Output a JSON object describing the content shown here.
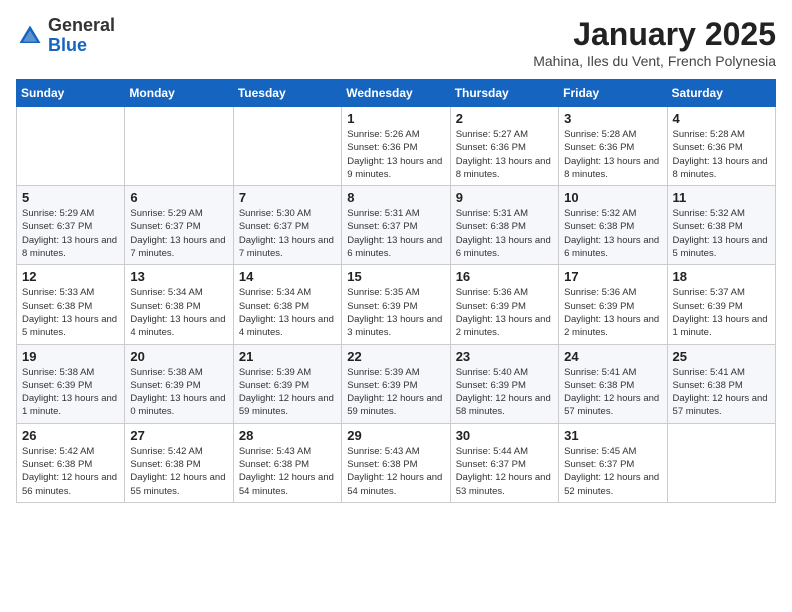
{
  "header": {
    "logo_general": "General",
    "logo_blue": "Blue",
    "title": "January 2025",
    "subtitle": "Mahina, Iles du Vent, French Polynesia"
  },
  "days_of_week": [
    "Sunday",
    "Monday",
    "Tuesday",
    "Wednesday",
    "Thursday",
    "Friday",
    "Saturday"
  ],
  "weeks": [
    [
      {
        "day": "",
        "info": ""
      },
      {
        "day": "",
        "info": ""
      },
      {
        "day": "",
        "info": ""
      },
      {
        "day": "1",
        "info": "Sunrise: 5:26 AM\nSunset: 6:36 PM\nDaylight: 13 hours and 9 minutes."
      },
      {
        "day": "2",
        "info": "Sunrise: 5:27 AM\nSunset: 6:36 PM\nDaylight: 13 hours and 8 minutes."
      },
      {
        "day": "3",
        "info": "Sunrise: 5:28 AM\nSunset: 6:36 PM\nDaylight: 13 hours and 8 minutes."
      },
      {
        "day": "4",
        "info": "Sunrise: 5:28 AM\nSunset: 6:36 PM\nDaylight: 13 hours and 8 minutes."
      }
    ],
    [
      {
        "day": "5",
        "info": "Sunrise: 5:29 AM\nSunset: 6:37 PM\nDaylight: 13 hours and 8 minutes."
      },
      {
        "day": "6",
        "info": "Sunrise: 5:29 AM\nSunset: 6:37 PM\nDaylight: 13 hours and 7 minutes."
      },
      {
        "day": "7",
        "info": "Sunrise: 5:30 AM\nSunset: 6:37 PM\nDaylight: 13 hours and 7 minutes."
      },
      {
        "day": "8",
        "info": "Sunrise: 5:31 AM\nSunset: 6:37 PM\nDaylight: 13 hours and 6 minutes."
      },
      {
        "day": "9",
        "info": "Sunrise: 5:31 AM\nSunset: 6:38 PM\nDaylight: 13 hours and 6 minutes."
      },
      {
        "day": "10",
        "info": "Sunrise: 5:32 AM\nSunset: 6:38 PM\nDaylight: 13 hours and 6 minutes."
      },
      {
        "day": "11",
        "info": "Sunrise: 5:32 AM\nSunset: 6:38 PM\nDaylight: 13 hours and 5 minutes."
      }
    ],
    [
      {
        "day": "12",
        "info": "Sunrise: 5:33 AM\nSunset: 6:38 PM\nDaylight: 13 hours and 5 minutes."
      },
      {
        "day": "13",
        "info": "Sunrise: 5:34 AM\nSunset: 6:38 PM\nDaylight: 13 hours and 4 minutes."
      },
      {
        "day": "14",
        "info": "Sunrise: 5:34 AM\nSunset: 6:38 PM\nDaylight: 13 hours and 4 minutes."
      },
      {
        "day": "15",
        "info": "Sunrise: 5:35 AM\nSunset: 6:39 PM\nDaylight: 13 hours and 3 minutes."
      },
      {
        "day": "16",
        "info": "Sunrise: 5:36 AM\nSunset: 6:39 PM\nDaylight: 13 hours and 2 minutes."
      },
      {
        "day": "17",
        "info": "Sunrise: 5:36 AM\nSunset: 6:39 PM\nDaylight: 13 hours and 2 minutes."
      },
      {
        "day": "18",
        "info": "Sunrise: 5:37 AM\nSunset: 6:39 PM\nDaylight: 13 hours and 1 minute."
      }
    ],
    [
      {
        "day": "19",
        "info": "Sunrise: 5:38 AM\nSunset: 6:39 PM\nDaylight: 13 hours and 1 minute."
      },
      {
        "day": "20",
        "info": "Sunrise: 5:38 AM\nSunset: 6:39 PM\nDaylight: 13 hours and 0 minutes."
      },
      {
        "day": "21",
        "info": "Sunrise: 5:39 AM\nSunset: 6:39 PM\nDaylight: 12 hours and 59 minutes."
      },
      {
        "day": "22",
        "info": "Sunrise: 5:39 AM\nSunset: 6:39 PM\nDaylight: 12 hours and 59 minutes."
      },
      {
        "day": "23",
        "info": "Sunrise: 5:40 AM\nSunset: 6:39 PM\nDaylight: 12 hours and 58 minutes."
      },
      {
        "day": "24",
        "info": "Sunrise: 5:41 AM\nSunset: 6:38 PM\nDaylight: 12 hours and 57 minutes."
      },
      {
        "day": "25",
        "info": "Sunrise: 5:41 AM\nSunset: 6:38 PM\nDaylight: 12 hours and 57 minutes."
      }
    ],
    [
      {
        "day": "26",
        "info": "Sunrise: 5:42 AM\nSunset: 6:38 PM\nDaylight: 12 hours and 56 minutes."
      },
      {
        "day": "27",
        "info": "Sunrise: 5:42 AM\nSunset: 6:38 PM\nDaylight: 12 hours and 55 minutes."
      },
      {
        "day": "28",
        "info": "Sunrise: 5:43 AM\nSunset: 6:38 PM\nDaylight: 12 hours and 54 minutes."
      },
      {
        "day": "29",
        "info": "Sunrise: 5:43 AM\nSunset: 6:38 PM\nDaylight: 12 hours and 54 minutes."
      },
      {
        "day": "30",
        "info": "Sunrise: 5:44 AM\nSunset: 6:37 PM\nDaylight: 12 hours and 53 minutes."
      },
      {
        "day": "31",
        "info": "Sunrise: 5:45 AM\nSunset: 6:37 PM\nDaylight: 12 hours and 52 minutes."
      },
      {
        "day": "",
        "info": ""
      }
    ]
  ]
}
